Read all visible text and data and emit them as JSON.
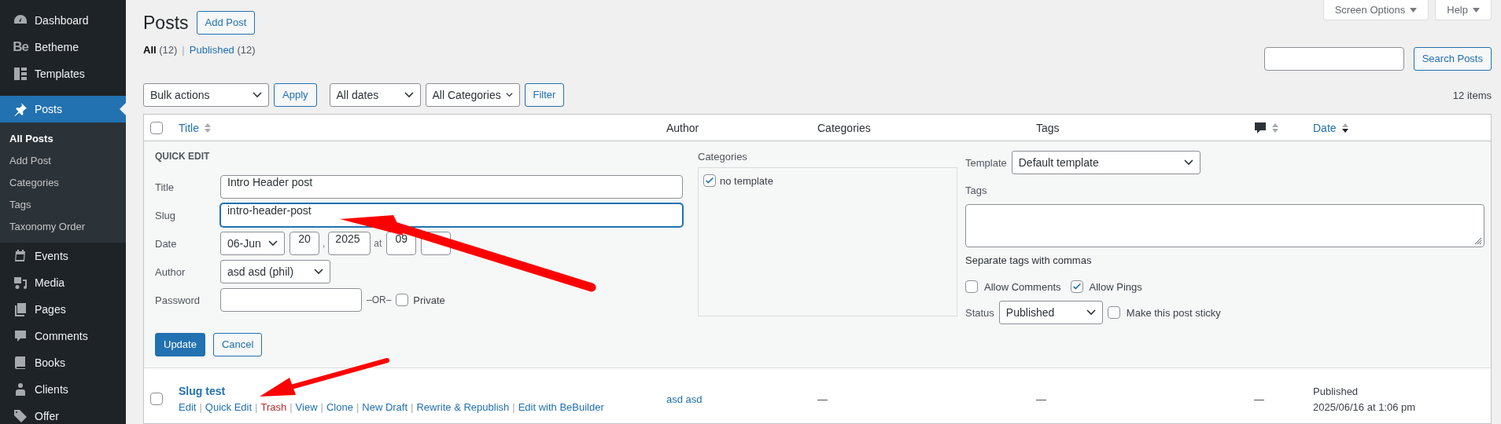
{
  "sidebar": {
    "items": [
      {
        "label": "Dashboard",
        "selected": false
      },
      {
        "label": "Betheme",
        "icon_text": "Be",
        "selected": false
      },
      {
        "label": "Templates",
        "selected": false
      },
      {
        "label": "Posts",
        "selected": true,
        "children": [
          {
            "label": "All Posts",
            "selected": true
          },
          {
            "label": "Add Post",
            "selected": false
          },
          {
            "label": "Categories",
            "selected": false
          },
          {
            "label": "Tags",
            "selected": false
          },
          {
            "label": "Taxonomy Order",
            "selected": false
          }
        ]
      },
      {
        "label": "Events",
        "selected": false
      },
      {
        "label": "Media",
        "selected": false
      },
      {
        "label": "Pages",
        "selected": false
      },
      {
        "label": "Comments",
        "selected": false
      },
      {
        "label": "Books",
        "selected": false
      },
      {
        "label": "Clients",
        "selected": false
      },
      {
        "label": "Offer",
        "selected": false
      }
    ]
  },
  "header": {
    "title": "Posts",
    "add_button": "Add Post",
    "screen_options": "Screen Options",
    "help": "Help",
    "views_separator": "|",
    "views": [
      {
        "label": "All",
        "count": "(12)",
        "selected": true
      },
      {
        "label": "Published",
        "count": "(12)",
        "selected": false
      }
    ],
    "search_button": "Search Posts"
  },
  "toolbar": {
    "bulk_actions": "Bulk actions",
    "apply": "Apply",
    "dates": "All dates",
    "categories": "All Categories",
    "filter": "Filter",
    "count": "12 items"
  },
  "table": {
    "select_all_checked": false,
    "action_separator": "|",
    "columns": [
      {
        "kind": "text",
        "label": "Title",
        "sorted": false
      },
      {
        "kind": "text",
        "label": "Author"
      },
      {
        "kind": "text",
        "label": "Categories"
      },
      {
        "kind": "text",
        "label": "Tags"
      },
      {
        "kind": "comments",
        "sorted": false
      },
      {
        "kind": "text",
        "label": "Date",
        "sorted": true
      }
    ],
    "quick_edit": {
      "heading": "QUICK EDIT",
      "title": {
        "label": "Title",
        "value": "Intro Header post"
      },
      "slug": {
        "label": "Slug",
        "value": "intro-header-post"
      },
      "date": {
        "label": "Date",
        "month": "06-Jun",
        "day": "20",
        "separator": ",",
        "year": "2025",
        "at": "at",
        "hour": "09"
      },
      "author": {
        "label": "Author",
        "value": "asd asd (phil)"
      },
      "password": {
        "label": "Password",
        "or": "–OR–"
      },
      "private": {
        "label": "Private",
        "checked": false
      },
      "categories": {
        "label": "Categories",
        "items": [
          {
            "label": "no template",
            "checked": true
          }
        ]
      },
      "template": {
        "label": "Template",
        "value": "Default template"
      },
      "tags": {
        "label": "Tags",
        "hint": "Separate tags with commas"
      },
      "allow_comments": {
        "label": "Allow Comments",
        "checked": false
      },
      "allow_pings": {
        "label": "Allow Pings",
        "checked": true
      },
      "status": {
        "label": "Status",
        "value": "Published"
      },
      "sticky": {
        "label": "Make this post sticky",
        "checked": false
      },
      "update": "Update",
      "cancel": "Cancel"
    },
    "rows": [
      {
        "title": "Slug test",
        "checked": false,
        "actions": [
          {
            "label": "Edit",
            "kind": "link"
          },
          {
            "label": "Quick Edit",
            "kind": "link"
          },
          {
            "label": "Trash",
            "kind": "delete"
          },
          {
            "label": "View",
            "kind": "link"
          },
          {
            "label": "Clone",
            "kind": "link"
          },
          {
            "label": "New Draft",
            "kind": "link"
          },
          {
            "label": "Rewrite & Republish",
            "kind": "link"
          },
          {
            "label": "Edit with BeBuilder",
            "kind": "link"
          }
        ],
        "author": "asd asd",
        "categories": "—",
        "tags": "—",
        "comments": "—",
        "date_status": "Published",
        "date": "2025/06/16 at 1:06 pm"
      }
    ]
  }
}
